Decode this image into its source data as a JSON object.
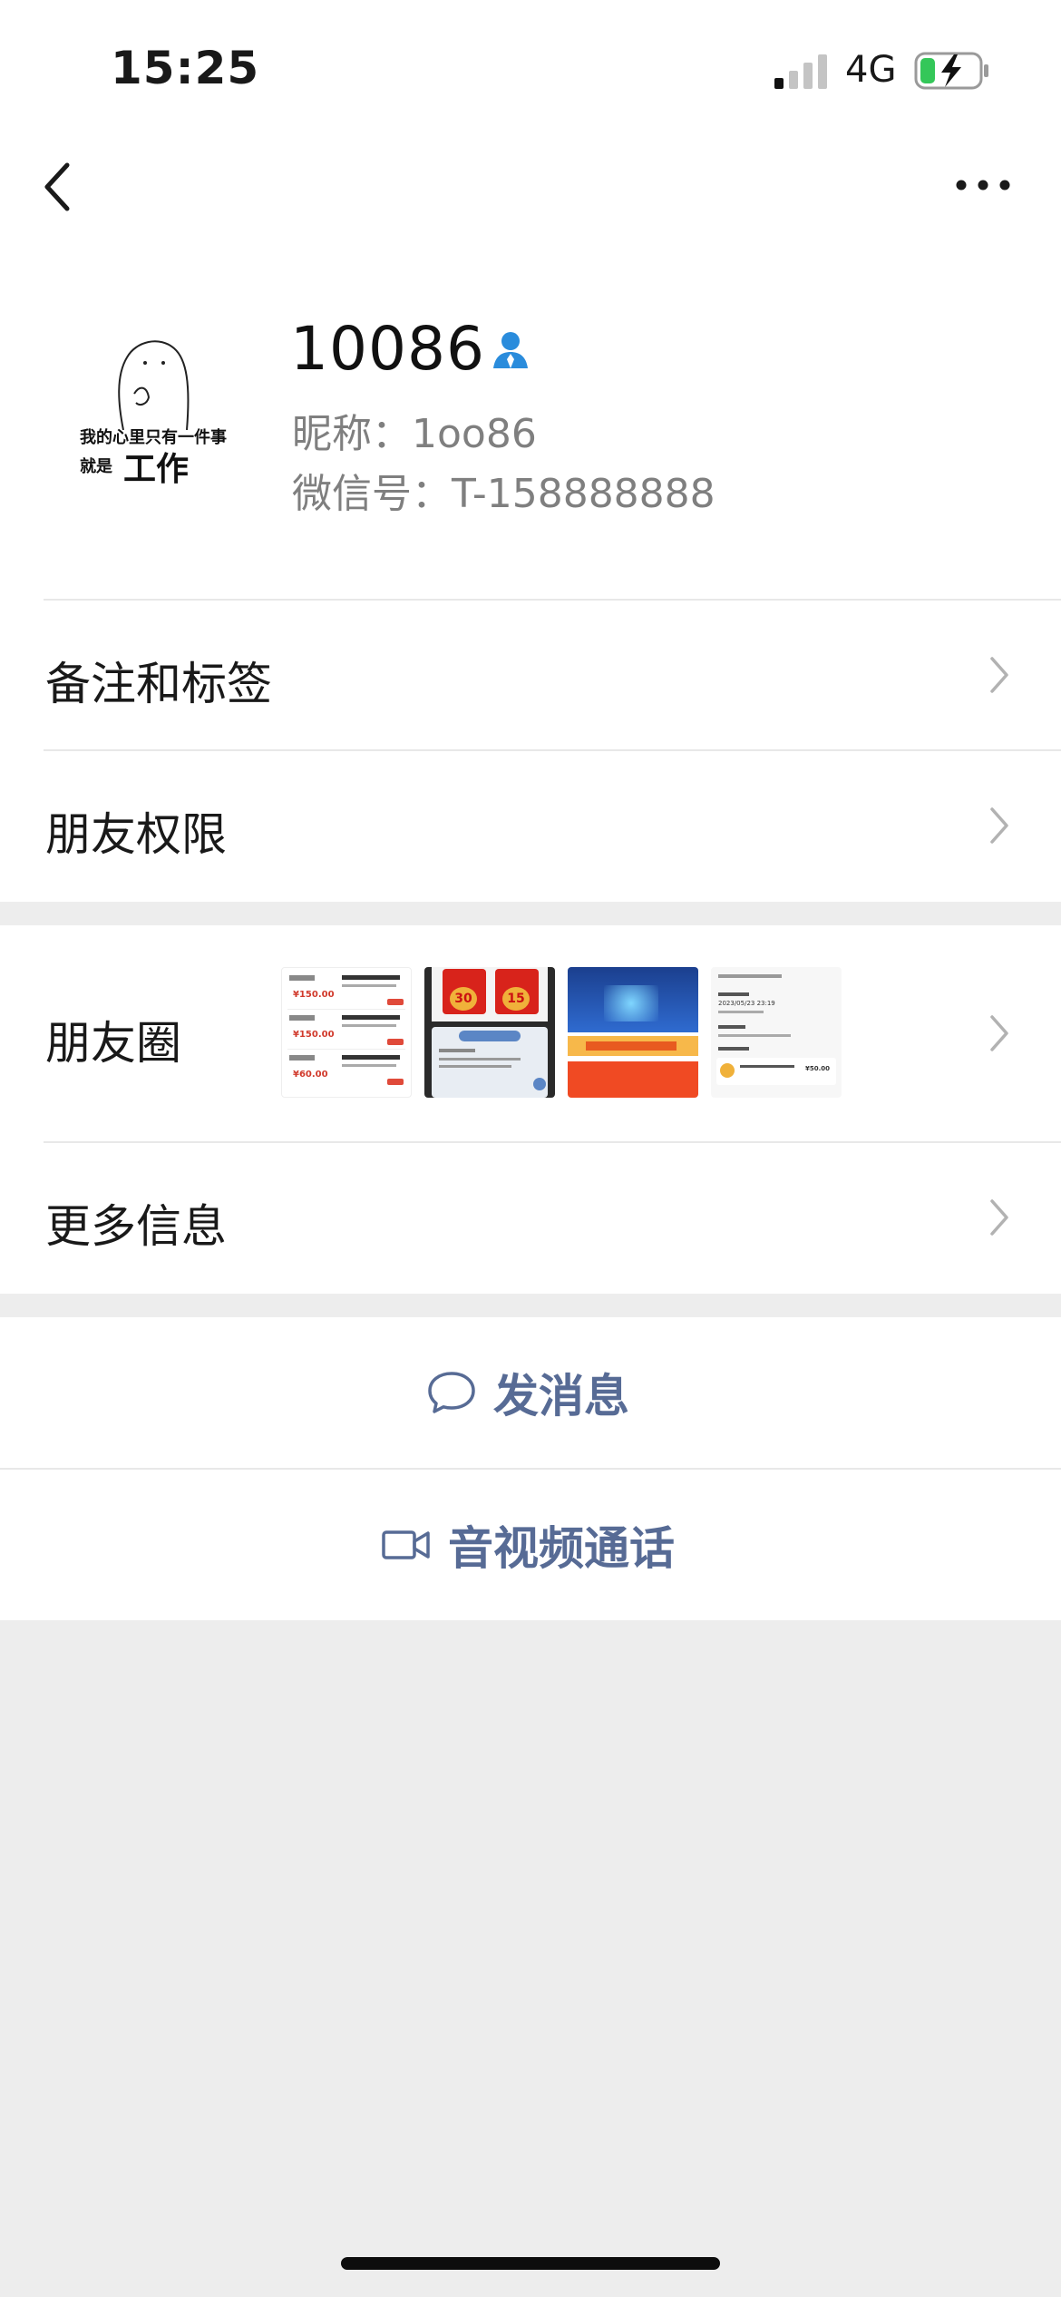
{
  "status_bar": {
    "time": "15:25",
    "network": "4G"
  },
  "profile": {
    "name": "10086",
    "nickname": "昵称：1oo86",
    "wechat_id": "微信号：T-158888888",
    "avatar_text_line1": "我的心里只有一件事",
    "avatar_text_line2": "就是",
    "avatar_text_big": "工作"
  },
  "menu": {
    "remarks_tags": "备注和标签",
    "friend_permissions": "朋友权限",
    "moments": "朋友圈",
    "more_info": "更多信息"
  },
  "moments_thumbs": {
    "t1_price1": "¥150.00",
    "t1_price2": "¥150.00",
    "t1_price3": "¥60.00",
    "t2_value1": "30",
    "t2_value2": "15",
    "t4_date": "2023/05/23 23:19",
    "t4_amount": "¥50.00"
  },
  "actions": {
    "send_message": "发消息",
    "av_call": "音视频通话"
  },
  "colors": {
    "link_blue": "#576b95",
    "background": "#ededed",
    "contact_icon": "#2a8cdc",
    "battery_green": "#34c759"
  }
}
